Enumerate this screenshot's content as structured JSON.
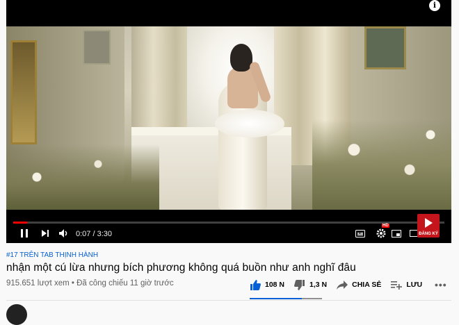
{
  "player": {
    "current_time": "0:07",
    "duration": "3:30",
    "time_separator": " / ",
    "progress_fraction": 0.033,
    "info_icon": "i",
    "hd_badge": "HD",
    "subscribe_badge": "ĐĂNG KÝ",
    "icons": [
      "play-pause-icon",
      "next-icon",
      "volume-icon",
      "subtitles-icon",
      "settings-icon",
      "miniplayer-icon",
      "theater-icon",
      "fullscreen-icon"
    ]
  },
  "video": {
    "trending_tag": "#17 TRÊN TAB THỊNH HÀNH",
    "title": "nhận một cú lừa nhưng bích phương không quá buồn như anh nghĩ đâu",
    "views": "915.651 lượt xem",
    "separator": " • ",
    "premiered": "Đã công chiếu 11 giờ trước"
  },
  "actions": {
    "likes": "108 N",
    "dislikes": "1,3 N",
    "share": "CHIA SẺ",
    "save": "LƯU",
    "more": "•••"
  },
  "colors": {
    "accent": "#065fd4",
    "progress": "#ff0000",
    "brand_red": "#c4151c"
  }
}
